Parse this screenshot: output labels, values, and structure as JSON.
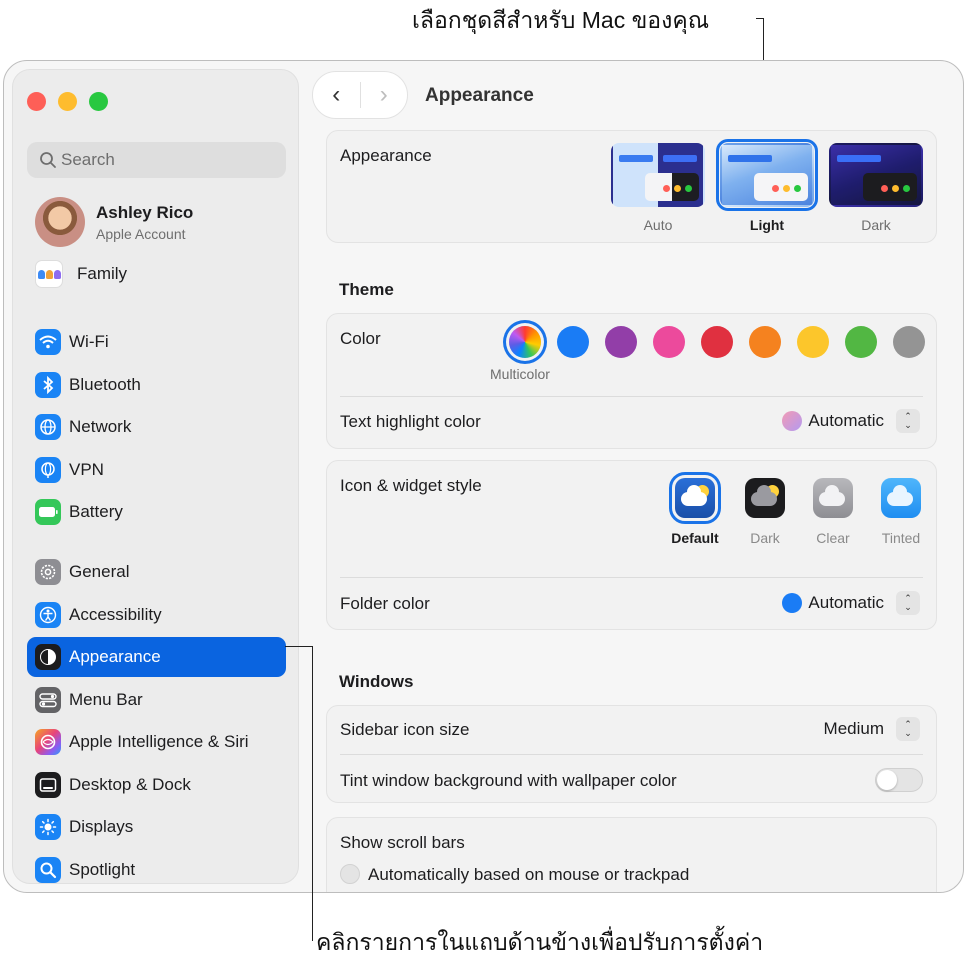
{
  "callouts": {
    "top": "เลือกชุดสีสำหรับ Mac ของคุณ",
    "bottom": "คลิกรายการในแถบด้านข้างเพื่อปรับการตั้งค่า"
  },
  "sidebar": {
    "search_placeholder": "Search",
    "account": {
      "name": "Ashley Rico",
      "subtitle": "Apple Account"
    },
    "family_label": "Family",
    "items": [
      {
        "label": "Wi-Fi",
        "icon": "wifi-icon",
        "color": "#1a84f5"
      },
      {
        "label": "Bluetooth",
        "icon": "bluetooth-icon",
        "color": "#1a84f5"
      },
      {
        "label": "Network",
        "icon": "globe-icon",
        "color": "#1a84f5"
      },
      {
        "label": "VPN",
        "icon": "vpn-globe-icon",
        "color": "#1a84f5"
      },
      {
        "label": "Battery",
        "icon": "battery-icon",
        "color": "#34c759"
      },
      {
        "label": "General",
        "icon": "gear-icon",
        "color": "#8e8e93"
      },
      {
        "label": "Accessibility",
        "icon": "accessibility-icon",
        "color": "#1a84f5"
      },
      {
        "label": "Appearance",
        "icon": "appearance-icon",
        "color": "#1c1c1e",
        "selected": true
      },
      {
        "label": "Menu Bar",
        "icon": "menu-bar-icon",
        "color": "#636366"
      },
      {
        "label": "Apple Intelligence & Siri",
        "icon": "siri-icon",
        "color": "#b44fe0"
      },
      {
        "label": "Desktop & Dock",
        "icon": "dock-icon",
        "color": "#1c1c1e"
      },
      {
        "label": "Displays",
        "icon": "sun-icon",
        "color": "#1a84f5"
      },
      {
        "label": "Spotlight",
        "icon": "magnifier-icon",
        "color": "#1a84f5"
      }
    ]
  },
  "header": {
    "title": "Appearance",
    "back": "‹",
    "forward": "›"
  },
  "appearance": {
    "label": "Appearance",
    "options": [
      {
        "label": "Auto",
        "selected": false
      },
      {
        "label": "Light",
        "selected": true
      },
      {
        "label": "Dark",
        "selected": false
      }
    ]
  },
  "theme": {
    "section_title": "Theme",
    "color_label": "Color",
    "selected_color_caption": "Multicolor",
    "colors": [
      "multicolor",
      "#1a7cf5",
      "#923ea8",
      "#ec4a9c",
      "#e03040",
      "#f5821f",
      "#fcc62b",
      "#52b743",
      "#949494"
    ],
    "highlight_label": "Text highlight color",
    "highlight_value": "Automatic"
  },
  "widget": {
    "label": "Icon & widget style",
    "options": [
      {
        "label": "Default",
        "selected": true
      },
      {
        "label": "Dark",
        "selected": false
      },
      {
        "label": "Clear",
        "selected": false
      },
      {
        "label": "Tinted",
        "selected": false
      }
    ],
    "folder_label": "Folder color",
    "folder_value": "Automatic"
  },
  "windows": {
    "section_title": "Windows",
    "sidebar_icon_label": "Sidebar icon size",
    "sidebar_icon_value": "Medium",
    "tint_label": "Tint window background with wallpaper color",
    "tint_on": false
  },
  "scrollbars": {
    "label": "Show scroll bars",
    "option1": "Automatically based on mouse or trackpad"
  }
}
